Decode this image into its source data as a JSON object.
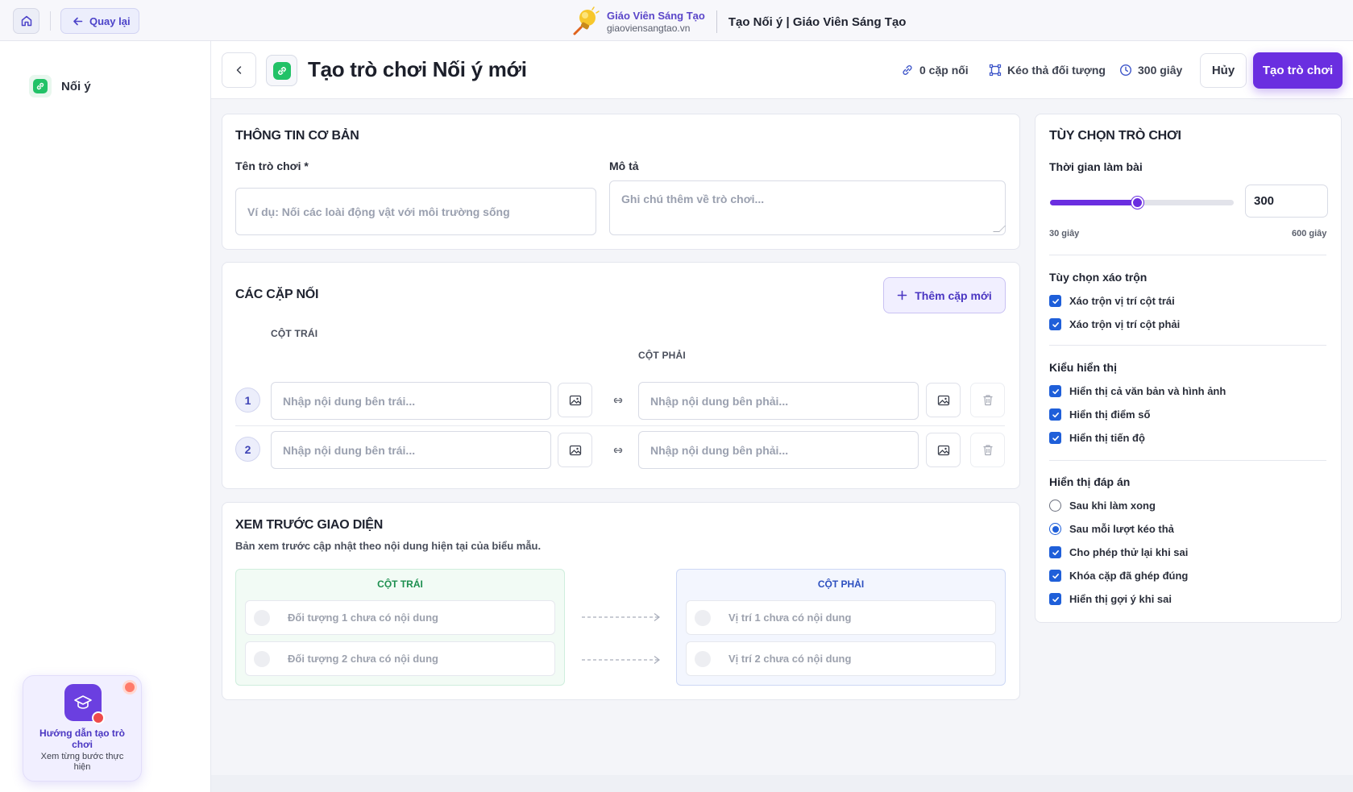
{
  "topbar": {
    "back_label": "Quay lại",
    "brand_name": "Giáo Viên Sáng Tạo",
    "brand_url": "giaoviensangtao.vn",
    "page_heading": "Tạo Nối ý | Giáo Viên Sáng Tạo"
  },
  "sidebar": {
    "item_label": "Nối ý",
    "guide": {
      "title": "Hướng dẫn tạo trò chơi",
      "subtitle": "Xem từng bước thực hiện"
    }
  },
  "header": {
    "title": "Tạo trò chơi Nối ý mới",
    "stat_pairs": "0 cặp nối",
    "stat_mode": "Kéo thả đối tượng",
    "stat_time": "300 giây",
    "cancel_label": "Hủy",
    "create_label": "Tạo trò chơi"
  },
  "basic_info": {
    "section_title": "THÔNG TIN CƠ BẢN",
    "name_label": "Tên trò chơi *",
    "name_placeholder": "Ví dụ: Nối các loài động vật với môi trường sống",
    "desc_label": "Mô tả",
    "desc_placeholder": "Ghi chú thêm về trò chơi..."
  },
  "pairs": {
    "section_title": "CÁC CẶP NỐI",
    "add_label": "Thêm cặp mới",
    "left_col": "CỘT TRÁI",
    "right_col": "CỘT PHẢI",
    "rows": [
      {
        "num": "1",
        "left_placeholder": "Nhập nội dung bên trái...",
        "right_placeholder": "Nhập nội dung bên phải..."
      },
      {
        "num": "2",
        "left_placeholder": "Nhập nội dung bên trái...",
        "right_placeholder": "Nhập nội dung bên phải..."
      }
    ]
  },
  "preview": {
    "section_title": "XEM TRƯỚC GIAO DIỆN",
    "subtitle": "Bản xem trước cập nhật theo nội dung hiện tại của biểu mẫu.",
    "left_head": "CỘT TRÁI",
    "right_head": "CỘT PHẢI",
    "left_items": [
      "Đối tượng 1 chưa có nội dung",
      "Đối tượng 2 chưa có nội dung"
    ],
    "right_items": [
      "Vị trí 1 chưa có nội dung",
      "Vị trí 2 chưa có nội dung"
    ]
  },
  "options": {
    "section_title": "TÙY CHỌN TRÒ CHƠI",
    "time_label": "Thời gian làm bài",
    "time_value": "300",
    "time_min_label": "30 giây",
    "time_max_label": "600 giây",
    "time_min": 30,
    "time_max": 600,
    "time_current": 300,
    "shuffle_title": "Tùy chọn xáo trộn",
    "shuffle": [
      "Xáo trộn vị trí cột trái",
      "Xáo trộn vị trí cột phải"
    ],
    "display_title": "Kiểu hiển thị",
    "display": [
      "Hiển thị cả văn bản và hình ảnh",
      "Hiển thị điểm số",
      "Hiển thị tiến độ"
    ],
    "answer_title": "Hiển thị đáp án",
    "answer_radio": [
      "Sau khi làm xong",
      "Sau mỗi lượt kéo thả"
    ],
    "answer_radio_selected": 1,
    "answer_checks": [
      "Cho phép thử lại khi sai",
      "Khóa cặp đã ghép đúng",
      "Hiển thị gợi ý khi sai"
    ]
  },
  "colors": {
    "accent": "#6a2ee0",
    "brand": "#5a46c9",
    "checkbox": "#1f5fd9",
    "success": "#22c267"
  }
}
